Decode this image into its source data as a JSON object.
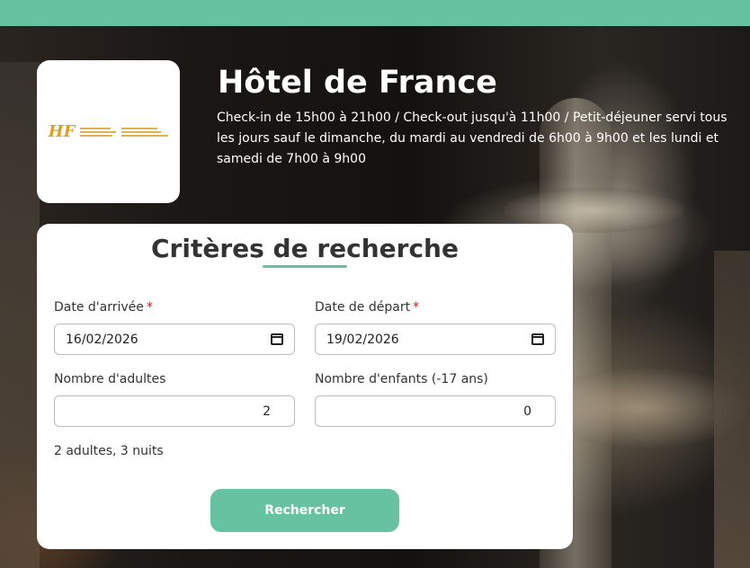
{
  "colors": {
    "accent": "#66c2a0",
    "required": "#dd1111"
  },
  "hotel": {
    "name": "Hôtel de France",
    "description": "Check-in de 15h00 à 21h00 / Check-out jusqu'à 11h00 / Petit-déjeuner servi tous les jours sauf le dimanche, du mardi au vendredi de 6h00 à 9h00 et les lundi et samedi de 7h00 à 9h00",
    "logo_mark": "HF"
  },
  "search": {
    "title": "Critères de recherche",
    "arrival_label": "Date d'arrivée",
    "arrival_value": "16/02/2026",
    "departure_label": "Date de départ",
    "departure_value": "19/02/2026",
    "required_mark": "*",
    "adults_label": "Nombre d'adultes",
    "adults_value": "2",
    "children_label": "Nombre d'enfants (-17 ans)",
    "children_value": "0",
    "summary": "2 adultes, 3 nuits",
    "button_label": "Rechercher"
  }
}
